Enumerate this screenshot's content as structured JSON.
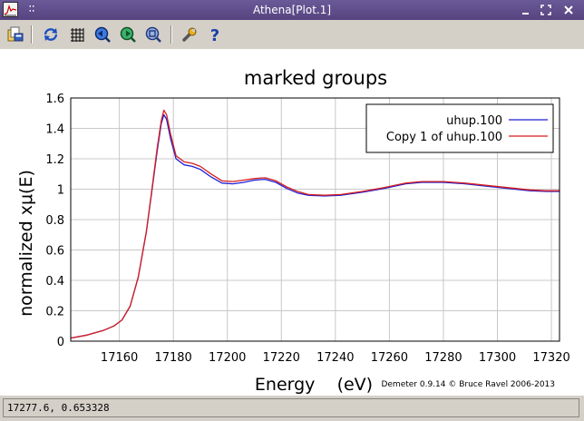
{
  "window": {
    "title": "Athena[Plot.1]",
    "controls": [
      "minimize-icon",
      "maximize-icon",
      "close-icon"
    ]
  },
  "toolbar": {
    "buttons": [
      {
        "name": "open-file-button",
        "icon": "open-folder-icon"
      },
      {
        "name": "refresh-button",
        "icon": "refresh-icon"
      },
      {
        "name": "grid-button",
        "icon": "grid-icon"
      },
      {
        "name": "zoom-out-button",
        "icon": "zoom-out-icon"
      },
      {
        "name": "zoom-in-button",
        "icon": "zoom-in-icon"
      },
      {
        "name": "zoom-fit-button",
        "icon": "zoom-fit-icon"
      },
      {
        "name": "settings-button",
        "icon": "wrench-icon"
      },
      {
        "name": "help-button",
        "icon": "help-icon",
        "label": "?"
      }
    ]
  },
  "chart_data": {
    "type": "line",
    "title": "marked groups",
    "xlabel": "Energy    (eV)",
    "ylabel": "normalized xμ(E)",
    "xlim": [
      17142,
      17323
    ],
    "ylim": [
      0,
      1.6
    ],
    "xticks": [
      17160,
      17180,
      17200,
      17220,
      17240,
      17260,
      17280,
      17300,
      17320
    ],
    "yticks": [
      0,
      0.2,
      0.4,
      0.6,
      0.8,
      1,
      1.2,
      1.4,
      1.6
    ],
    "ytick_labels": [
      "0",
      "0.2",
      "0.4",
      "0.6",
      "0.8",
      "1",
      "1.2",
      "1.4",
      "1.6"
    ],
    "grid": true,
    "legend_position": "top-right",
    "series": [
      {
        "name": "uhup.100",
        "color": "#1f1fd6",
        "x": [
          17142,
          17148,
          17154,
          17158,
          17161,
          17164,
          17167,
          17170,
          17172,
          17174,
          17175.5,
          17176.5,
          17177.5,
          17179,
          17181,
          17184,
          17187,
          17190,
          17194,
          17198,
          17202,
          17206,
          17210,
          17214,
          17218,
          17222,
          17226,
          17230,
          17236,
          17242,
          17250,
          17258,
          17266,
          17272,
          17280,
          17288,
          17296,
          17304,
          17312,
          17318,
          17323
        ],
        "y": [
          0.02,
          0.04,
          0.07,
          0.1,
          0.14,
          0.23,
          0.42,
          0.72,
          0.98,
          1.25,
          1.43,
          1.49,
          1.46,
          1.33,
          1.2,
          1.16,
          1.15,
          1.13,
          1.08,
          1.04,
          1.035,
          1.045,
          1.06,
          1.065,
          1.045,
          1.005,
          0.975,
          0.96,
          0.955,
          0.96,
          0.98,
          1.005,
          1.035,
          1.045,
          1.045,
          1.035,
          1.02,
          1.005,
          0.99,
          0.985,
          0.985
        ]
      },
      {
        "name": "Copy 1 of uhup.100",
        "color": "#d61f1f",
        "x": [
          17142,
          17148,
          17154,
          17158,
          17161,
          17164,
          17167,
          17170,
          17172,
          17174,
          17175.5,
          17176.5,
          17177.5,
          17179,
          17181,
          17184,
          17187,
          17190,
          17194,
          17198,
          17202,
          17206,
          17210,
          17214,
          17218,
          17222,
          17226,
          17230,
          17236,
          17242,
          17250,
          17258,
          17266,
          17272,
          17280,
          17288,
          17296,
          17304,
          17312,
          17318,
          17323
        ],
        "y": [
          0.02,
          0.04,
          0.07,
          0.1,
          0.14,
          0.23,
          0.42,
          0.72,
          0.99,
          1.27,
          1.45,
          1.52,
          1.49,
          1.36,
          1.22,
          1.18,
          1.17,
          1.15,
          1.1,
          1.055,
          1.05,
          1.06,
          1.07,
          1.075,
          1.055,
          1.015,
          0.985,
          0.965,
          0.96,
          0.965,
          0.985,
          1.01,
          1.04,
          1.05,
          1.05,
          1.04,
          1.025,
          1.01,
          0.995,
          0.99,
          0.99
        ]
      }
    ],
    "annotation": "Demeter 0.9.14 © Bruce Ravel 2006-2013"
  },
  "status": {
    "text": "17277.6, 0.653328"
  }
}
